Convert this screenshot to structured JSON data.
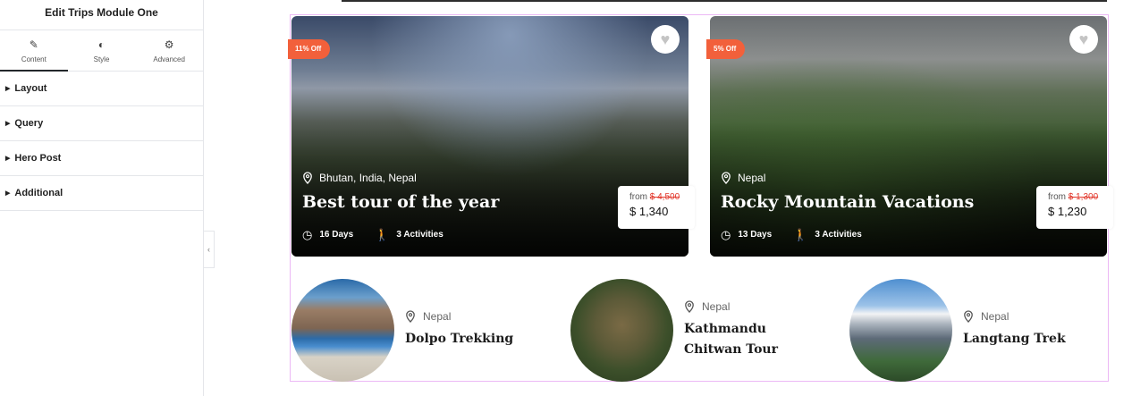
{
  "editor": {
    "title": "Edit Trips Module One",
    "tabs": [
      {
        "label": "Content",
        "icon": "pencil-icon",
        "active": true
      },
      {
        "label": "Style",
        "icon": "contrast-icon",
        "active": false
      },
      {
        "label": "Advanced",
        "icon": "gear-icon",
        "active": false
      }
    ],
    "sections": [
      "Layout",
      "Query",
      "Hero Post",
      "Additional"
    ],
    "collapse_icon": "‹"
  },
  "hero_trips": [
    {
      "discount": "11% Off",
      "location": "Bhutan, India, Nepal",
      "title": "Best tour of the year",
      "duration": "16 Days",
      "activities": "3 Activities",
      "price_from_label": "from",
      "price_old": "$ 4,500",
      "price_now": "$ 1,340"
    },
    {
      "discount": "5% Off",
      "location": "Nepal",
      "title": "Rocky Mountain Vacations",
      "duration": "13 Days",
      "activities": "3 Activities",
      "price_from_label": "from",
      "price_old": "$ 1,300",
      "price_now": "$ 1,230"
    }
  ],
  "small_trips": [
    {
      "location": "Nepal",
      "title": "Dolpo Trekking"
    },
    {
      "location": "Nepal",
      "title": "Kathmandu Chitwan Tour"
    },
    {
      "location": "Nepal",
      "title": "Langtang Trek"
    }
  ],
  "colors": {
    "discount_badge": "#f2603b",
    "old_price": "#e2372b",
    "module_outline": "#ecb8f5"
  }
}
